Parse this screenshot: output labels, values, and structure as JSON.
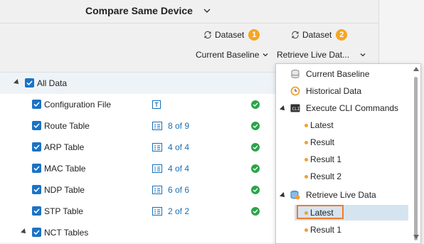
{
  "title": "Compare Same Device",
  "datasets": [
    {
      "label": "Dataset",
      "badge": "1",
      "selected": "Current Baseline"
    },
    {
      "label": "Dataset",
      "badge": "2",
      "selected": "Retrieve Live Dat..."
    }
  ],
  "tree": [
    {
      "label": "All Data",
      "checked": true,
      "expandable": true,
      "count": "",
      "status": ""
    },
    {
      "label": "Configuration File",
      "checked": true,
      "count": "",
      "type_icon": "text-file-icon",
      "status": "ok"
    },
    {
      "label": "Route Table",
      "checked": true,
      "count": "8 of 9",
      "type_icon": "table-list-icon",
      "status": "ok"
    },
    {
      "label": "ARP Table",
      "checked": true,
      "count": "4 of 4",
      "type_icon": "table-list-icon",
      "status": "ok"
    },
    {
      "label": "MAC Table",
      "checked": true,
      "count": "4 of 4",
      "type_icon": "table-list-icon",
      "status": "ok"
    },
    {
      "label": "NDP Table",
      "checked": true,
      "count": "6 of 6",
      "type_icon": "table-list-icon",
      "status": "ok"
    },
    {
      "label": "STP Table",
      "checked": true,
      "count": "2 of 2",
      "type_icon": "table-list-icon",
      "status": "ok"
    },
    {
      "label": "NCT Tables",
      "checked": true,
      "expandable": true,
      "count": "",
      "status": ""
    }
  ],
  "dropdown": {
    "items": [
      {
        "label": "Current Baseline",
        "icon": "database-icon",
        "level": 0
      },
      {
        "label": "Historical Data",
        "icon": "clock-icon",
        "level": 0
      },
      {
        "label": "Execute CLI Commands",
        "icon": "cli-icon",
        "level": 0,
        "expandable": true
      },
      {
        "label": "Latest",
        "level": 1
      },
      {
        "label": "Result",
        "level": 1
      },
      {
        "label": "Result 1",
        "level": 1
      },
      {
        "label": "Result 2",
        "level": 1
      },
      {
        "label": "Retrieve Live Data",
        "icon": "live-data-icon",
        "level": 0,
        "expandable": true
      },
      {
        "label": "Latest",
        "level": 1,
        "highlighted": true
      },
      {
        "label": "Result 1",
        "level": 1
      }
    ]
  },
  "colors": {
    "accent": "#1a73c6",
    "badge": "#f5a623",
    "ok": "#2aa44a",
    "focus": "#f07a2b",
    "bullet": "#f0a030"
  }
}
